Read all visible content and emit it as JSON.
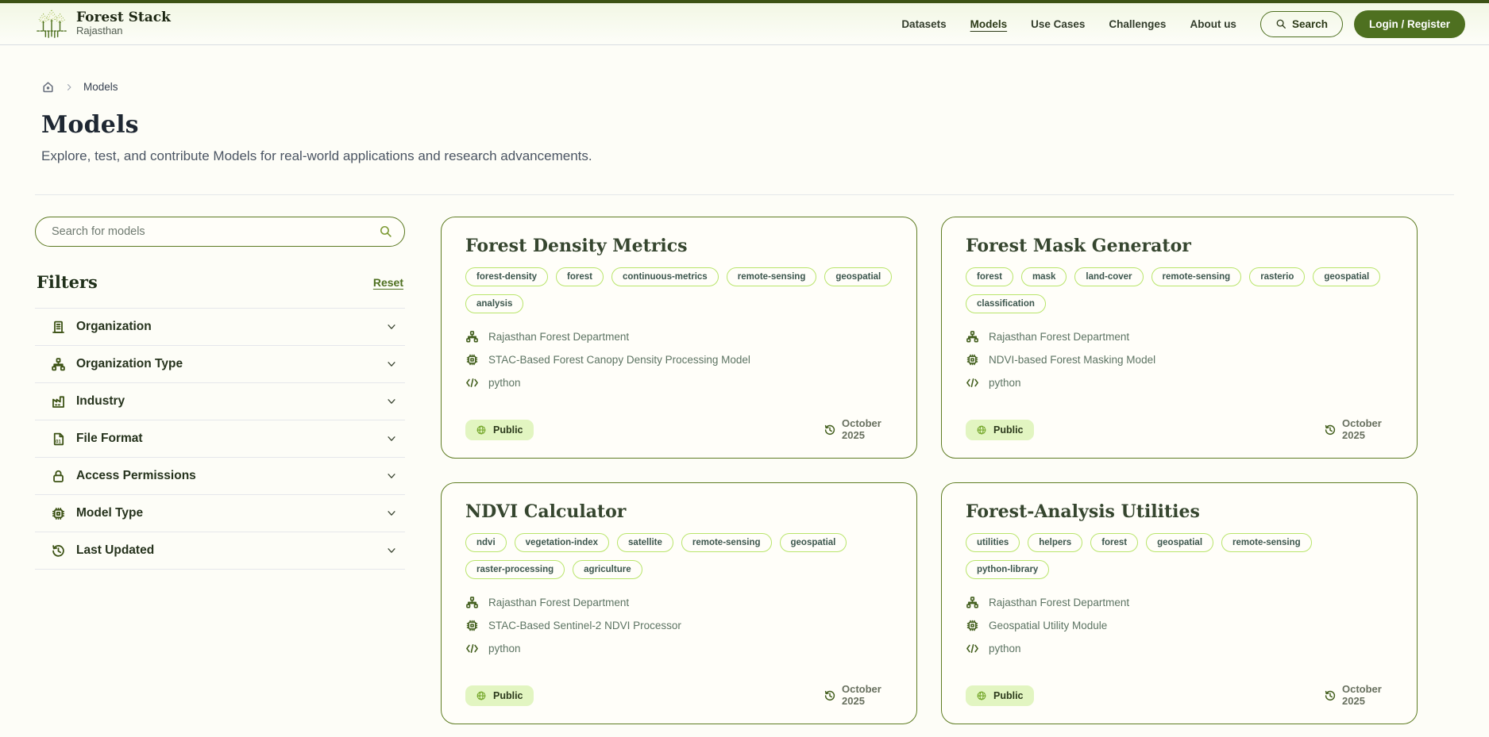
{
  "brand": {
    "title": "Forest Stack",
    "subtitle": "Rajasthan"
  },
  "nav": {
    "items": [
      {
        "label": "Datasets",
        "active": false
      },
      {
        "label": "Models",
        "active": true
      },
      {
        "label": "Use Cases",
        "active": false
      },
      {
        "label": "Challenges",
        "active": false
      },
      {
        "label": "About us",
        "active": false
      }
    ],
    "search_label": "Search",
    "login_label": "Login / Register"
  },
  "breadcrumb": {
    "current": "Models"
  },
  "page": {
    "title": "Models",
    "subtitle": "Explore, test, and contribute Models for real-world applications and research advancements."
  },
  "sidebar": {
    "search_placeholder": "Search for models",
    "filters_title": "Filters",
    "reset_label": "Reset",
    "filters": [
      {
        "label": "Organization",
        "icon": "building-icon"
      },
      {
        "label": "Organization Type",
        "icon": "org-chart-icon"
      },
      {
        "label": "Industry",
        "icon": "factory-icon"
      },
      {
        "label": "File Format",
        "icon": "file-format-icon"
      },
      {
        "label": "Access Permissions",
        "icon": "lock-icon"
      },
      {
        "label": "Model Type",
        "icon": "chip-icon"
      },
      {
        "label": "Last Updated",
        "icon": "history-icon"
      }
    ]
  },
  "cards": [
    {
      "title": "Forest Density Metrics",
      "tags": [
        "forest-density",
        "forest",
        "continuous-metrics",
        "remote-sensing",
        "geospatial",
        "analysis"
      ],
      "organization": "Rajasthan Forest Department",
      "model": "STAC-Based Forest Canopy Density Processing Model",
      "language": "python",
      "visibility": "Public",
      "updated": "October 2025"
    },
    {
      "title": "Forest Mask Generator",
      "tags": [
        "forest",
        "mask",
        "land-cover",
        "remote-sensing",
        "rasterio",
        "geospatial",
        "classification"
      ],
      "organization": "Rajasthan Forest Department",
      "model": "NDVI-based Forest Masking Model",
      "language": "python",
      "visibility": "Public",
      "updated": "October 2025"
    },
    {
      "title": "NDVI Calculator",
      "tags": [
        "ndvi",
        "vegetation-index",
        "satellite",
        "remote-sensing",
        "geospatial",
        "raster-processing",
        "agriculture"
      ],
      "organization": "Rajasthan Forest Department",
      "model": "STAC-Based Sentinel-2 NDVI Processor",
      "language": "python",
      "visibility": "Public",
      "updated": "October 2025"
    },
    {
      "title": "Forest-Analysis Utilities",
      "tags": [
        "utilities",
        "helpers",
        "forest",
        "geospatial",
        "remote-sensing",
        "python-library"
      ],
      "organization": "Rajasthan Forest Department",
      "model": "Geospatial Utility Module",
      "language": "python",
      "visibility": "Public",
      "updated": "October 2025"
    }
  ],
  "colors": {
    "accent_olive": "#4e7020",
    "top_strip": "#3c5214",
    "card_border": "#5f7d23",
    "tag_border": "#b9e56b",
    "badge_bg": "#e2f5c1"
  }
}
